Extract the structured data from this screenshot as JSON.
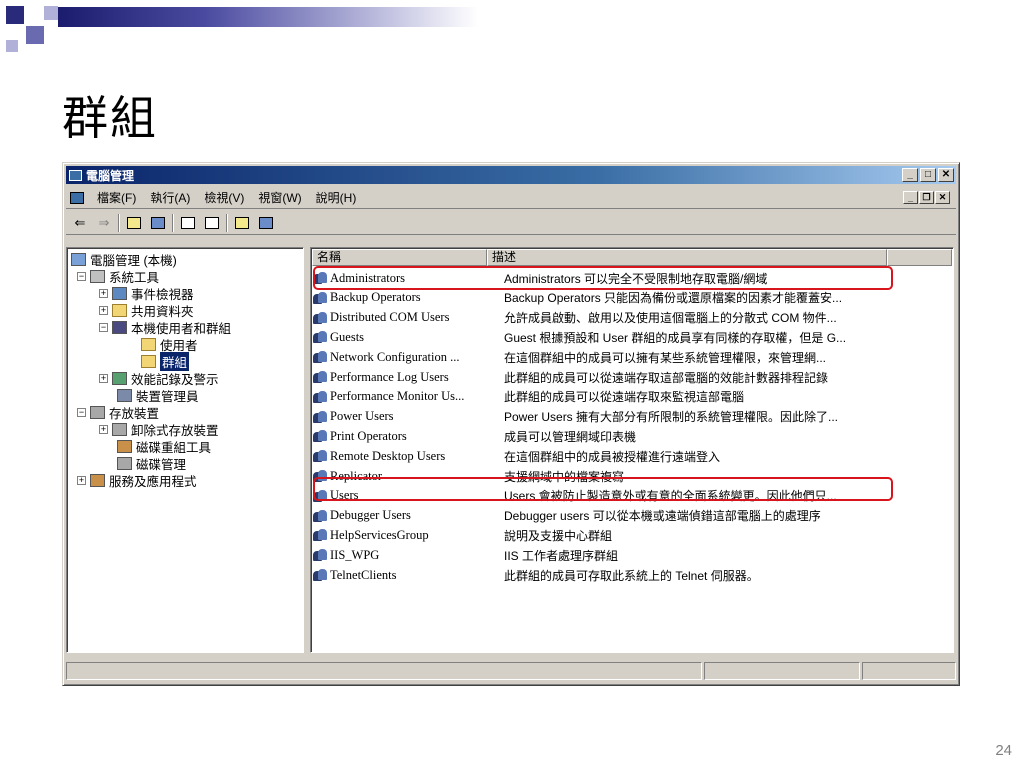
{
  "slide": {
    "title": "群組",
    "page_number": "24",
    "colors": {
      "deco_dark": "#1c1c6e",
      "deco_mid": "#4a4aa0",
      "highlight": "#d8141c"
    }
  },
  "window": {
    "title": "電腦管理",
    "menu": [
      "檔案(F)",
      "執行(A)",
      "檢視(V)",
      "視窗(W)",
      "說明(H)"
    ],
    "toolbar_icons": [
      "back-arrow-icon",
      "forward-arrow-icon",
      "up-folder-icon",
      "show-tree-icon",
      "refresh-icon",
      "export-list-icon",
      "help-icon",
      "console-icon"
    ]
  },
  "tree": {
    "items": [
      {
        "label": "電腦管理 (本機)",
        "icon": "computer-icon",
        "expander": ""
      },
      {
        "label": "系統工具",
        "icon": "tools-icon",
        "expander": "−"
      },
      {
        "label": "事件檢視器",
        "icon": "event-viewer-icon",
        "expander": "+"
      },
      {
        "label": "共用資料夾",
        "icon": "shared-folder-icon",
        "expander": "+"
      },
      {
        "label": "本機使用者和群組",
        "icon": "users-groups-icon",
        "expander": "−"
      },
      {
        "label": "使用者",
        "icon": "folder-icon",
        "expander": ""
      },
      {
        "label": "群組",
        "icon": "folder-open-icon",
        "expander": "",
        "selected": true
      },
      {
        "label": "效能記錄及警示",
        "icon": "performance-icon",
        "expander": "+"
      },
      {
        "label": "裝置管理員",
        "icon": "device-manager-icon",
        "expander": ""
      },
      {
        "label": "存放裝置",
        "icon": "storage-icon",
        "expander": "−"
      },
      {
        "label": "卸除式存放裝置",
        "icon": "removable-storage-icon",
        "expander": "+"
      },
      {
        "label": "磁碟重組工具",
        "icon": "defrag-icon",
        "expander": ""
      },
      {
        "label": "磁碟管理",
        "icon": "disk-management-icon",
        "expander": ""
      },
      {
        "label": "服務及應用程式",
        "icon": "services-icon",
        "expander": "+"
      }
    ]
  },
  "list": {
    "columns": [
      "名稱",
      "描述"
    ],
    "rows": [
      {
        "name": "Administrators",
        "desc": "Administrators 可以完全不受限制地存取電腦/網域",
        "highlighted": true
      },
      {
        "name": "Backup Operators",
        "desc": "Backup Operators 只能因為備份或還原檔案的因素才能覆蓋安..."
      },
      {
        "name": "Distributed COM Users",
        "desc": "允許成員啟動、啟用以及使用這個電腦上的分散式 COM 物件..."
      },
      {
        "name": "Guests",
        "desc": "Guest 根據預設和 User 群組的成員享有同樣的存取權，但是 G..."
      },
      {
        "name": "Network Configuration ...",
        "desc": "在這個群組中的成員可以擁有某些系統管理權限，來管理網..."
      },
      {
        "name": "Performance Log Users",
        "desc": "此群組的成員可以從遠端存取這部電腦的效能計數器排程記錄"
      },
      {
        "name": "Performance Monitor Us...",
        "desc": "此群組的成員可以從遠端存取來監視這部電腦"
      },
      {
        "name": "Power Users",
        "desc": "Power Users 擁有大部分有所限制的系統管理權限。因此除了..."
      },
      {
        "name": "Print Operators",
        "desc": "成員可以管理網域印表機"
      },
      {
        "name": "Remote Desktop Users",
        "desc": "在這個群組中的成員被授權進行遠端登入"
      },
      {
        "name": "Replicator",
        "desc": "支援網域中的檔案複寫"
      },
      {
        "name": "Users",
        "desc": "Users 會被防止製造意外或有意的全面系統變更。因此他們只...",
        "highlighted": true
      },
      {
        "name": "Debugger Users",
        "desc": "Debugger users 可以從本機或遠端偵錯這部電腦上的處理序"
      },
      {
        "name": "HelpServicesGroup",
        "desc": "說明及支援中心群組"
      },
      {
        "name": "IIS_WPG",
        "desc": "IIS 工作者處理序群組"
      },
      {
        "name": "TelnetClients",
        "desc": "此群組的成員可存取此系統上的 Telnet 伺服器。"
      }
    ]
  }
}
